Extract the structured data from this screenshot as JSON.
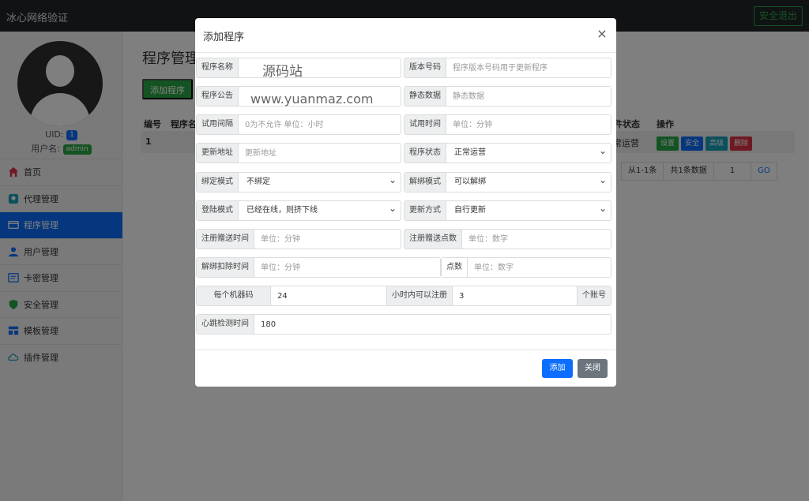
{
  "topbar": {
    "brand": "冰心网络验证",
    "logout": "安全退出"
  },
  "sidebar": {
    "uid_label": "UID:",
    "uid_value": "1",
    "username_label": "用户名:",
    "username_value": "admin",
    "items": [
      {
        "label": "首页",
        "icon": "home-icon"
      },
      {
        "label": "代理管理",
        "icon": "agent-icon"
      },
      {
        "label": "程序管理",
        "icon": "program-icon",
        "active": true
      },
      {
        "label": "用户管理",
        "icon": "user-icon"
      },
      {
        "label": "卡密管理",
        "icon": "card-icon"
      },
      {
        "label": "安全管理",
        "icon": "shield-icon"
      },
      {
        "label": "模板管理",
        "icon": "template-icon"
      },
      {
        "label": "插件管理",
        "icon": "plugin-icon"
      }
    ]
  },
  "main": {
    "title": "程序管理",
    "add_button": "添加程序",
    "columns_left": [
      "编号",
      "程序名"
    ],
    "columns_right": [
      "件状态",
      "操作"
    ],
    "row": {
      "id": "1",
      "status": "常运营"
    },
    "ops": [
      "设置",
      "安全",
      "高级",
      "删除"
    ],
    "pager": [
      "从1-1条",
      "共1条数据",
      "1",
      "GO"
    ]
  },
  "modal": {
    "title": "添加程序",
    "close": "×",
    "fields": {
      "name": {
        "label": "程序名称",
        "value": "",
        "placeholder": ""
      },
      "version": {
        "label": "版本号码",
        "placeholder": "程序版本号码用于更新程序"
      },
      "notice": {
        "label": "程序公告",
        "value": "",
        "placeholder": ""
      },
      "static_data": {
        "label": "静态数据",
        "placeholder": "静态数据"
      },
      "trial_interval": {
        "label": "试用间隔",
        "placeholder": "0为不允许 单位：小时"
      },
      "trial_time": {
        "label": "试用时间",
        "placeholder": "单位：分钟"
      },
      "update_url": {
        "label": "更新地址",
        "placeholder": "更新地址"
      },
      "status": {
        "label": "程序状态",
        "value": "正常运营"
      },
      "bind_mode": {
        "label": "绑定模式",
        "value": "不绑定"
      },
      "unbind_mode": {
        "label": "解绑模式",
        "value": "可以解绑"
      },
      "login_mode": {
        "label": "登陆模式",
        "value": "已经在线，则挤下线"
      },
      "update_mode": {
        "label": "更新方式",
        "value": "自行更新"
      },
      "reg_gift_time": {
        "label": "注册赠送时间",
        "placeholder": "单位：分钟"
      },
      "reg_gift_points": {
        "label": "注册赠送点数",
        "placeholder": "单位：数字"
      },
      "unbind_deduct_time": {
        "label": "解绑扣除时间",
        "placeholder": "单位：分钟"
      },
      "unbind_deduct_points": {
        "label": "点数",
        "placeholder": "单位：数字"
      },
      "per_machine": {
        "label": "每个机器码",
        "value": "24"
      },
      "hours_register": {
        "label": "小时内可以注册",
        "value": "3",
        "suffix": "个账号"
      },
      "heartbeat": {
        "label": "心跳检测时间",
        "value": "180"
      }
    },
    "watermark1": "源码站",
    "watermark2": "www.yuanmaz.com",
    "add_button": "添加",
    "close_button": "关闭"
  },
  "colors": {
    "primary": "#0d6efd",
    "success": "#28a745",
    "danger": "#dc3545",
    "info": "#17a2b8",
    "secondary": "#6c757d",
    "topbar": "#212529"
  }
}
